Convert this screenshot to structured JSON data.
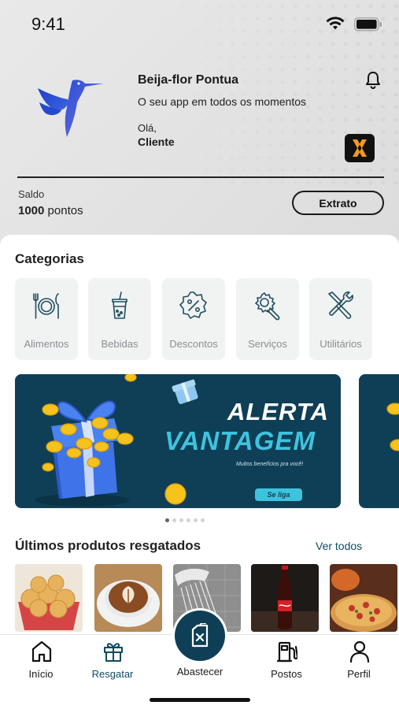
{
  "status_bar": {
    "time": "9:41"
  },
  "header": {
    "brand_title": "Beija-flor Pontua",
    "brand_subtitle": "O seu app em todos os momentos",
    "greeting": "Olá,",
    "user_name": "Cliente",
    "partner_badge": "X"
  },
  "balance": {
    "label": "Saldo",
    "amount": "1000",
    "unit": "pontos",
    "statement_button": "Extrato"
  },
  "categories": {
    "title": "Categorias",
    "items": [
      {
        "label": "Alimentos",
        "icon": "utensils-plate-icon"
      },
      {
        "label": "Bebidas",
        "icon": "drink-cup-icon"
      },
      {
        "label": "Descontos",
        "icon": "percent-badge-icon"
      },
      {
        "label": "Serviços",
        "icon": "gear-wrench-icon"
      },
      {
        "label": "Utilitários",
        "icon": "tools-icon"
      }
    ]
  },
  "banner": {
    "line1": "ALERTA",
    "line2": "VANTAGEM",
    "tagline": "Muitos benefícios pra você!",
    "cta": "Se liga",
    "page_count": 6,
    "active_page": 1
  },
  "recent_products": {
    "title": "Últimos produtos resgatados",
    "see_all": "Ver todos",
    "items": [
      {
        "icon": "cheese-bread-image"
      },
      {
        "icon": "cappuccino-image"
      },
      {
        "icon": "shower-image"
      },
      {
        "icon": "cola-bottle-image"
      },
      {
        "icon": "pizza-image"
      }
    ]
  },
  "bottom_nav": {
    "items": [
      {
        "label": "Início",
        "icon": "home-icon"
      },
      {
        "label": "Resgatar",
        "icon": "gift-icon",
        "active": true
      },
      {
        "label": "Abastecer",
        "icon": "fuel-can-icon"
      },
      {
        "label": "Postos",
        "icon": "gas-pump-icon"
      },
      {
        "label": "Perfil",
        "icon": "user-icon"
      }
    ]
  },
  "colors": {
    "primary": "#0f3f56",
    "accent": "#3ec3de",
    "link": "#0f4a63",
    "badge_orange": "#f39a1e"
  }
}
